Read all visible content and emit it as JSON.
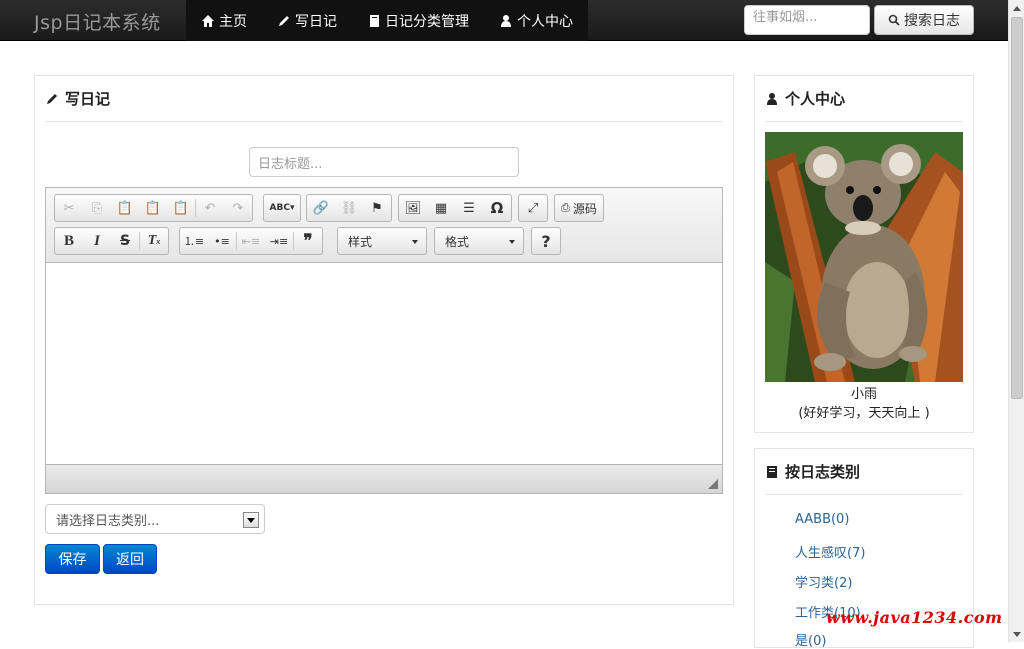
{
  "navbar": {
    "brand": "Jsp日记本系统",
    "items": [
      {
        "label": "主页",
        "icon": "home-icon"
      },
      {
        "label": "写日记",
        "icon": "pencil-icon"
      },
      {
        "label": "日记分类管理",
        "icon": "book-icon"
      },
      {
        "label": "个人中心",
        "icon": "user-icon"
      }
    ],
    "search_placeholder": "往事如烟...",
    "search_button": "搜索日志"
  },
  "main": {
    "heading": "写日记",
    "title_placeholder": "日志标题...",
    "editor": {
      "toolbar_row1": [
        "cut",
        "copy",
        "paste",
        "paste-text",
        "paste-word",
        "undo",
        "redo",
        "spellcheck",
        "link",
        "unlink",
        "anchor",
        "image",
        "table",
        "horizontal-rule",
        "special-char",
        "maximize"
      ],
      "source_label": "源码",
      "toolbar_row2": [
        "bold",
        "italic",
        "strike",
        "remove-format",
        "numbered-list",
        "bulleted-list",
        "outdent",
        "indent",
        "blockquote"
      ],
      "styles_label": "样式",
      "format_label": "格式",
      "help_label": "?"
    },
    "category_placeholder": "请选择日志类别...",
    "save_label": "保存",
    "back_label": "返回"
  },
  "sidebar": {
    "profile": {
      "heading": "个人中心",
      "name": "小雨",
      "motto": "(好好学习，天天向上 )"
    },
    "categories": {
      "heading": "按日志类别",
      "items": [
        {
          "label": "AABB(0)"
        },
        {
          "label": "人生感叹(7)"
        },
        {
          "label": "学习类(2)"
        },
        {
          "label": "工作类(10)"
        },
        {
          "label": "是(0)"
        }
      ]
    }
  },
  "watermark": "www.java1234.com",
  "colors": {
    "navbar": "#1b1b1b",
    "primary": "#0066cc",
    "link": "#2a6496",
    "watermark": "#e00000"
  }
}
